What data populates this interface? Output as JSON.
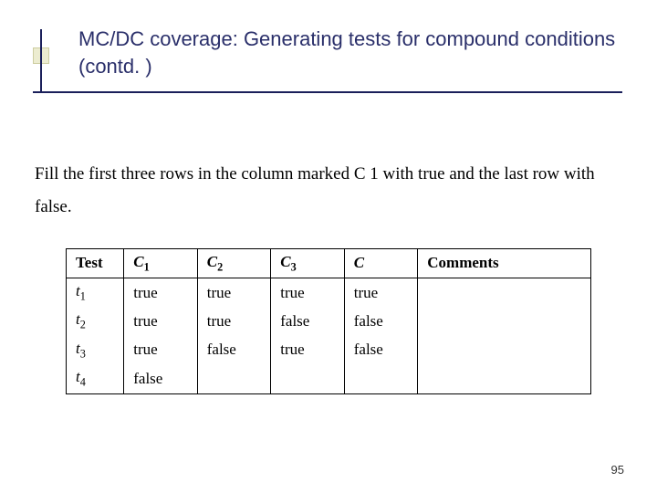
{
  "title": "MC/DC coverage: Generating tests for compound conditions (contd. )",
  "paragraph": "Fill the first three rows in the column marked C 1 with true and the last row with false.",
  "table": {
    "headers": {
      "test": "Test",
      "c1_base": "C",
      "c1_sub": "1",
      "c2_base": "C",
      "c2_sub": "2",
      "c3_base": "C",
      "c3_sub": "3",
      "c": "C",
      "comments": "Comments"
    },
    "rows": [
      {
        "test_base": "t",
        "test_sub": "1",
        "c1": "true",
        "c2": "true",
        "c3": "true",
        "c": "true",
        "comments": ""
      },
      {
        "test_base": "t",
        "test_sub": "2",
        "c1": "true",
        "c2": "true",
        "c3": "false",
        "c": "false",
        "comments": ""
      },
      {
        "test_base": "t",
        "test_sub": "3",
        "c1": "true",
        "c2": "false",
        "c3": "true",
        "c": "false",
        "comments": ""
      },
      {
        "test_base": "t",
        "test_sub": "4",
        "c1": "false",
        "c2": "",
        "c3": "",
        "c": "",
        "comments": ""
      }
    ]
  },
  "page_number": "95"
}
